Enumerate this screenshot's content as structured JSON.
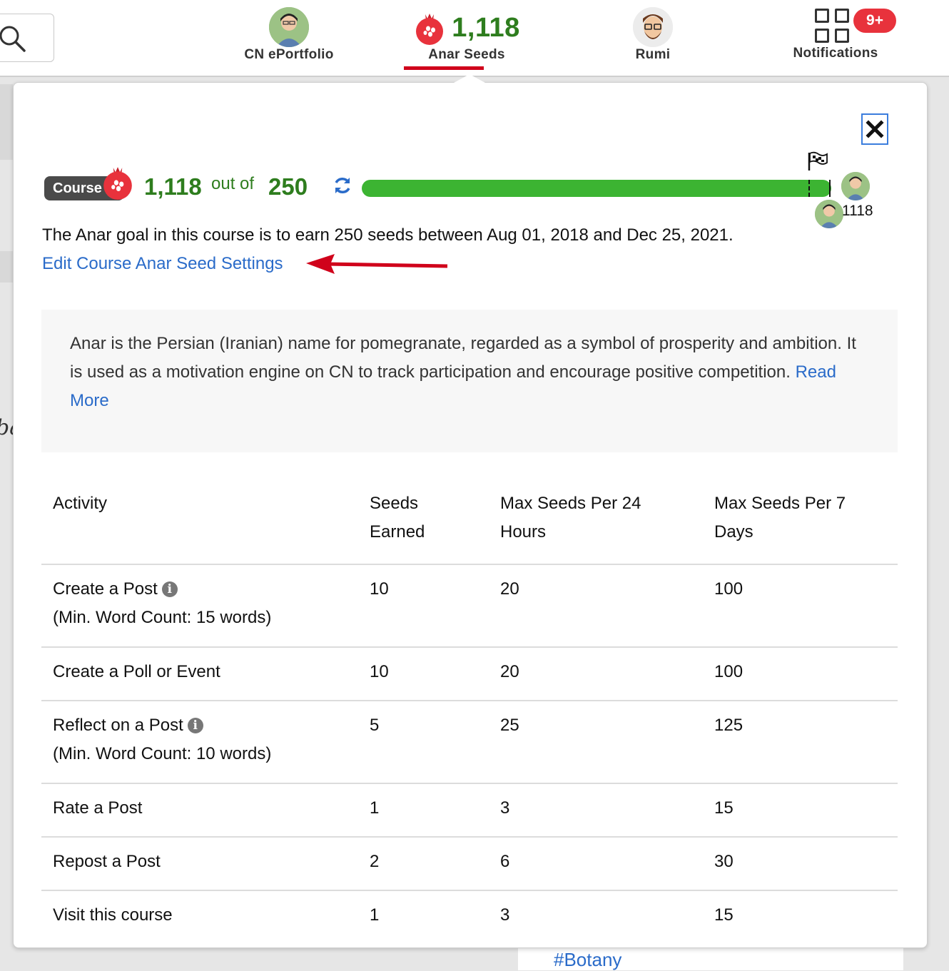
{
  "nav": {
    "eportfolio_label": "CN ePortfolio",
    "anar_count": "1,118",
    "anar_label": "Anar Seeds",
    "rumi_label": "Rumi",
    "notifications_label": "Notifications",
    "notifications_badge": "9+"
  },
  "popover": {
    "course_pill": "Course",
    "seed_count": "1,118",
    "out_of": "out of",
    "goal_count": "250",
    "progress_fraction": 1.0,
    "me_count": "1118",
    "goal_text": "The Anar goal in this course is to earn 250 seeds between Aug 01, 2018 and Dec 25, 2021.",
    "edit_link": "Edit Course Anar Seed Settings",
    "info_text": "Anar is the Persian (Iranian) name for pomegranate, regarded as a symbol of prosperity and ambition. It is used as a motivation engine on CN to track participation and encourage positive competition.",
    "read_more": "Read More"
  },
  "table": {
    "headers": [
      "Activity",
      "Seeds Earned",
      "Max Seeds Per 24 Hours",
      "Max Seeds Per 7 Days"
    ],
    "rows": [
      {
        "activity": "Create a Post",
        "note": "(Min. Word Count: 15 words)",
        "earned": "10",
        "max24": "20",
        "max7": "100"
      },
      {
        "activity": "Create a Poll or Event",
        "note": "",
        "earned": "10",
        "max24": "20",
        "max7": "100"
      },
      {
        "activity": "Reflect on a Post",
        "note": "(Min. Word Count: 10 words)",
        "earned": "5",
        "max24": "25",
        "max7": "125"
      },
      {
        "activity": "Rate a Post",
        "note": "",
        "earned": "1",
        "max24": "3",
        "max7": "15"
      },
      {
        "activity": "Repost a Post",
        "note": "",
        "earned": "2",
        "max24": "6",
        "max7": "30"
      },
      {
        "activity": "Visit this course",
        "note": "",
        "earned": "1",
        "max24": "3",
        "max7": "15"
      }
    ]
  },
  "background": {
    "hashtag": "#Botany",
    "left_fragment": "ba"
  },
  "colors": {
    "seed_green": "#2e7d1e",
    "progress_green": "#3cb432",
    "link_blue": "#2a6bc9",
    "accent_red": "#d0021b",
    "badge_red": "#e8323c"
  }
}
